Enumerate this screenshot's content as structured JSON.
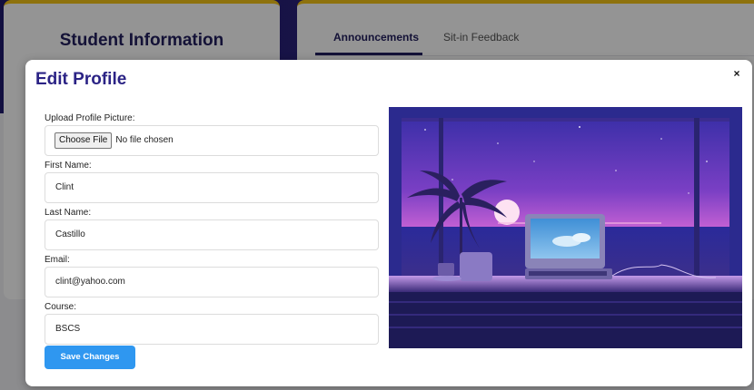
{
  "background": {
    "student_card_title": "Student Information",
    "tabs": [
      {
        "label": "Announcements",
        "active": true
      },
      {
        "label": "Sit-in Feedback",
        "active": false
      }
    ]
  },
  "modal": {
    "title": "Edit Profile",
    "close_glyph": "×",
    "close_icon": "close-icon",
    "fields": {
      "upload": {
        "label": "Upload Profile Picture:",
        "button": "Choose File",
        "status": "No file chosen"
      },
      "first_name": {
        "label": "First Name:",
        "value": "Clint"
      },
      "last_name": {
        "label": "Last Name:",
        "value": "Castillo"
      },
      "email": {
        "label": "Email:",
        "value": "clint@yahoo.com"
      },
      "course": {
        "label": "Course:",
        "value": "BSCS"
      }
    },
    "save_label": "Save Changes",
    "illustration_icon": "laptop-window-sunset-illustration"
  },
  "colors": {
    "accent_blue": "#2f97f0",
    "title_purple": "#2b2385",
    "header_gold": "#f5c518",
    "header_navy": "#1f1b6e"
  }
}
